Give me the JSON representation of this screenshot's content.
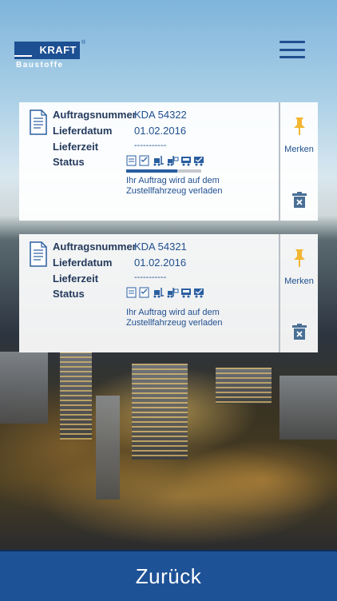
{
  "brand": {
    "name": "KRAFT",
    "sub": "Baustoffe",
    "reg": "®",
    "color": "#1d4f93"
  },
  "labels": {
    "order_number": "Auftragsnummer",
    "delivery_date": "Lieferdatum",
    "delivery_time": "Lieferzeit",
    "status": "Status",
    "bookmark": "Merken"
  },
  "orders": [
    {
      "order_number": "KDA 54322",
      "delivery_date": "01.02.2016",
      "delivery_time": "-----------",
      "status_text": "Ihr Auftrag wird auf dem Zustellfahrzeug verladen",
      "status_progress": 0.68
    },
    {
      "order_number": "KDA 54321",
      "delivery_date": "01.02.2016",
      "delivery_time": "-----------",
      "status_text": "Ihr Auftrag wird auf dem Zustellfahrzeug verladen",
      "status_progress": 0.0
    }
  ],
  "status_icons": [
    "document-icon",
    "checklist-icon",
    "forklift-icon",
    "forklift-loaded-icon",
    "truck-icon",
    "truck-delivered-icon"
  ],
  "footer": {
    "back_label": "Zurück",
    "color": "#1e5296"
  },
  "accent": {
    "pin_color": "#f2b632",
    "text_blue": "#1f4f8f"
  }
}
